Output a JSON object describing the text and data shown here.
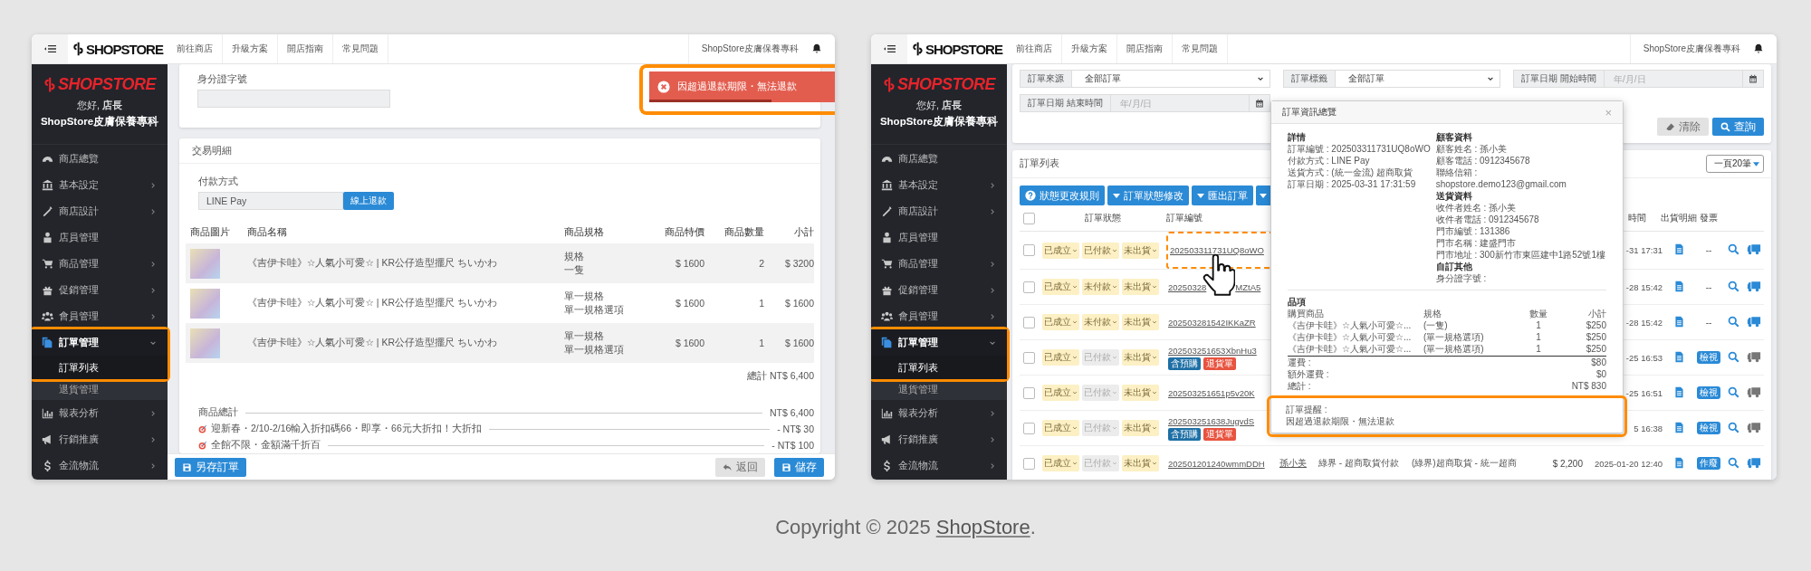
{
  "panels": [
    {
      "kind": "order_edit",
      "topbar": {
        "brand": "SHOPSTORE",
        "nav": [
          "前往商店",
          "升級方案",
          "開店指南",
          "常見問題"
        ],
        "store": "ShopStore皮膚保養專科"
      },
      "sidebar": {
        "brand": "SHOPSTORE",
        "greeting": "您好, **店長**",
        "store": "ShopStore皮膚保養專科",
        "menu": [
          {
            "label": "商店總覽",
            "expandable": false,
            "selected": false,
            "highlighted": false
          },
          {
            "label": "基本設定",
            "expandable": true,
            "expanded": false,
            "selected": false,
            "highlighted": false
          },
          {
            "label": "商店設計",
            "expandable": true,
            "expanded": false,
            "selected": false,
            "highlighted": false
          },
          {
            "label": "店員管理",
            "expandable": false,
            "selected": false,
            "highlighted": false
          },
          {
            "label": "商品管理",
            "expandable": true,
            "expanded": false,
            "selected": false,
            "highlighted": false
          },
          {
            "label": "促銷管理",
            "expandable": true,
            "expanded": false,
            "selected": false,
            "highlighted": false
          },
          {
            "label": "會員管理",
            "expandable": true,
            "expanded": false,
            "selected": false,
            "highlighted": false
          },
          {
            "label": "訂單管理",
            "expandable": true,
            "expanded": true,
            "selected": true,
            "highlighted": true,
            "children": [
              {
                "label": "訂單列表",
                "selected": true,
                "highlighted": true
              },
              {
                "label": "退貨管理",
                "selected": false,
                "highlighted": false
              }
            ]
          },
          {
            "label": "報表分析",
            "expandable": true,
            "expanded": false,
            "selected": false,
            "highlighted": false
          },
          {
            "label": "行銷推廣",
            "expandable": true,
            "expanded": false,
            "selected": false,
            "highlighted": false
          },
          {
            "label": "金流物流",
            "expandable": true,
            "expanded": false,
            "selected": false,
            "highlighted": false
          }
        ]
      },
      "main": {
        "id_field": {
          "label": "身分證字號"
        },
        "toast": {
          "message": "因超過退款期限・無法退款",
          "level": 0.62,
          "highlighted": true
        },
        "transaction": {
          "title": "交易明細",
          "payment_label": "付款方式",
          "payment_value": "LINE Pay",
          "refund_button": "線上退款",
          "columns": [
            "商品圖片",
            "商品名稱",
            "商品規格",
            "商品特價",
            "商品數量",
            "小計"
          ],
          "rows": [
            {
              "name": "《吉伊卡哇》☆人氣小可愛☆ | KR公仔造型擺尺 ちいかわ",
              "spec": [
                "規格",
                "一隻"
              ],
              "price": "$ 1600",
              "qty": "2",
              "subtotal": "$ 3200"
            },
            {
              "name": "《吉伊卡哇》☆人氣小可愛☆ | KR公仔造型擺尺 ちいかわ",
              "spec": [
                "單一規格",
                "單一規格選項"
              ],
              "price": "$ 1600",
              "qty": "1",
              "subtotal": "$ 1600"
            },
            {
              "name": "《吉伊卡哇》☆人氣小可愛☆ | KR公仔造型擺尺 ちいかわ",
              "spec": [
                "單一規格",
                "單一規格選項"
              ],
              "price": "$ 1600",
              "qty": "1",
              "subtotal": "$ 1600"
            }
          ],
          "total": "總計 NT$ 6,400",
          "summary": [
            {
              "kind": "plain",
              "label": "商品總計",
              "amount": "NT$ 6,400"
            },
            {
              "kind": "promo",
              "label": "迎新春・2/10-2/16輸入折扣碼66・即享・66元大折扣！大折扣",
              "amount": "- NT$ 30"
            },
            {
              "kind": "promo",
              "label": "全館不限・金額滿千折百",
              "amount": "- NT$ 100"
            }
          ]
        },
        "footer": {
          "save_as": "另存訂單",
          "back": {
            "label": "返回",
            "disabled": true
          },
          "save": "儲存"
        }
      }
    },
    {
      "kind": "order_list",
      "topbar": {
        "brand": "SHOPSTORE",
        "nav": [
          "前往商店",
          "升級方案",
          "開店指南",
          "常見問題"
        ],
        "store": "ShopStore皮膚保養專科"
      },
      "sidebar": {
        "brand": "SHOPSTORE",
        "greeting": "您好, **店長**",
        "store": "ShopStore皮膚保養專科",
        "menu": [
          {
            "label": "商店總覽",
            "expandable": false,
            "selected": false,
            "highlighted": false
          },
          {
            "label": "基本設定",
            "expandable": true,
            "expanded": false,
            "selected": false,
            "highlighted": false
          },
          {
            "label": "商店設計",
            "expandable": true,
            "expanded": false,
            "selected": false,
            "highlighted": false
          },
          {
            "label": "店員管理",
            "expandable": false,
            "selected": false,
            "highlighted": false
          },
          {
            "label": "商品管理",
            "expandable": true,
            "expanded": false,
            "selected": false,
            "highlighted": false
          },
          {
            "label": "促銷管理",
            "expandable": true,
            "expanded": false,
            "selected": false,
            "highlighted": false
          },
          {
            "label": "會員管理",
            "expandable": true,
            "expanded": false,
            "selected": false,
            "highlighted": false
          },
          {
            "label": "訂單管理",
            "expandable": true,
            "expanded": true,
            "selected": true,
            "highlighted": true,
            "children": [
              {
                "label": "訂單列表",
                "selected": true,
                "highlighted": true
              },
              {
                "label": "退貨管理",
                "selected": false,
                "highlighted": false
              }
            ]
          },
          {
            "label": "報表分析",
            "expandable": true,
            "expanded": false,
            "selected": false,
            "highlighted": false
          },
          {
            "label": "行銷推廣",
            "expandable": true,
            "expanded": false,
            "selected": false,
            "highlighted": false
          },
          {
            "label": "金流物流",
            "expandable": true,
            "expanded": false,
            "selected": false,
            "highlighted": false
          }
        ]
      },
      "main": {
        "filters": [
          {
            "kind": "select",
            "label": "訂單來源",
            "value": "全部訂單"
          },
          {
            "kind": "select",
            "label": "訂單標籤",
            "value": "全部訂單"
          },
          {
            "kind": "date",
            "label": "訂單日期 開始時間",
            "placeholder": "年/月/日"
          },
          {
            "kind": "date",
            "label": "訂單日期 結束時間",
            "placeholder": "年/月/日"
          }
        ],
        "clear_button": {
          "label": "清除",
          "disabled": true
        },
        "search_button": "查詢",
        "orders": {
          "title": "訂單列表",
          "page_size": "一頁20筆",
          "toolbar": [
            {
              "kind": "help",
              "label": "狀態更改規則"
            },
            {
              "kind": "dropdown",
              "label": "訂單狀態修改"
            },
            {
              "kind": "dropdown",
              "label": "匯出訂單"
            },
            {
              "kind": "dropdown"
            }
          ],
          "select_all_checked": false,
          "headers": {
            "status": "訂單狀態",
            "order_no": "訂單編號",
            "time": "時間",
            "shipping_doc": "出貨明細",
            "invoice": "發票"
          },
          "rows": [
            {
              "checked": false,
              "statuses": [
                {
                  "label": "已成立",
                  "disabled": false
                },
                {
                  "label": "已付款",
                  "disabled": false
                },
                {
                  "label": "未出貨",
                  "disabled": false
                }
              ],
              "order_no": "202503311731UQ8oWO",
              "highlighted": true,
              "time": "-31 17:31",
              "invoice": {
                "kind": "text",
                "label": "--"
              },
              "truck_active": true
            },
            {
              "checked": false,
              "statuses": [
                {
                  "label": "已成立",
                  "disabled": false
                },
                {
                  "label": "未付款",
                  "disabled": false
                },
                {
                  "label": "未出貨",
                  "disabled": false
                }
              ],
              "order_no": "20250328",
              "order_no_end": "MZtA5",
              "highlighted": false,
              "time": "-28 15:42",
              "invoice": {
                "kind": "text",
                "label": "--"
              },
              "truck_active": true
            },
            {
              "checked": false,
              "statuses": [
                {
                  "label": "已成立",
                  "disabled": false
                },
                {
                  "label": "未付款",
                  "disabled": false
                },
                {
                  "label": "未出貨",
                  "disabled": false
                }
              ],
              "order_no": "202503281542IKKaZR",
              "highlighted": false,
              "time": "-28 15:42",
              "invoice": {
                "kind": "text",
                "label": "--"
              },
              "truck_active": true
            },
            {
              "checked": false,
              "statuses": [
                {
                  "label": "已成立",
                  "disabled": false
                },
                {
                  "label": "已付款",
                  "disabled": true
                },
                {
                  "label": "未出貨",
                  "disabled": false
                }
              ],
              "order_no": "202503251653XbnHu3",
              "highlighted": false,
              "tags": [
                {
                  "label": "含預購",
                  "color": "#1d6fa5"
                },
                {
                  "label": "退貨單",
                  "color": "#e8533f"
                }
              ],
              "time": "-25 16:53",
              "invoice": {
                "kind": "badge",
                "label": "檢視"
              },
              "truck_active": false
            },
            {
              "checked": false,
              "statuses": [
                {
                  "label": "已成立",
                  "disabled": false
                },
                {
                  "label": "已付款",
                  "disabled": true
                },
                {
                  "label": "未出貨",
                  "disabled": false
                }
              ],
              "order_no": "202503251651p5v20K",
              "highlighted": false,
              "time": "-25 16:51",
              "invoice": {
                "kind": "badge",
                "label": "檢視"
              },
              "truck_active": false
            },
            {
              "checked": false,
              "statuses": [
                {
                  "label": "已成立",
                  "disabled": false
                },
                {
                  "label": "已付款",
                  "disabled": true
                },
                {
                  "label": "未出貨",
                  "disabled": false
                }
              ],
              "order_no": "202503251638JugvdS",
              "highlighted": false,
              "tags": [
                {
                  "label": "含預購",
                  "color": "#1d6fa5"
                },
                {
                  "label": "退貨單",
                  "color": "#e8533f"
                }
              ],
              "time": "5 16:38",
              "invoice": {
                "kind": "badge",
                "label": "檢視"
              },
              "truck_active": false
            },
            {
              "checked": false,
              "statuses": [
                {
                  "label": "已成立",
                  "disabled": false
                },
                {
                  "label": "已付款",
                  "disabled": true
                },
                {
                  "label": "未出貨",
                  "disabled": false
                }
              ],
              "order_no": "202501201240wmmDDH",
              "highlighted": false,
              "customer": "孫小美",
              "payment": "綠界 - 超商取貨付款",
              "shipping": "(綠界)超商取貨 - 統一超商",
              "amount": "$ 2,200",
              "time": "2025-01-20 12:40",
              "invoice": {
                "kind": "badge",
                "label": "作廢"
              },
              "truck_active": true
            }
          ]
        },
        "popup": {
          "title": "訂單資訊總覽",
          "close": "×",
          "left": [
            {
              "heading": "詳情",
              "lines": [
                "訂單編號 : 202503311731UQ8oWO",
                "付款方式 : LINE Pay",
                "送貨方式 : (統一金流) 超商取貨",
                "訂單日期 : 2025-03-31 17:31:59"
              ]
            }
          ],
          "right": [
            {
              "heading": "顧客資料",
              "lines": [
                "顧客姓名 : 孫小美",
                "顧客電話 : 0912345678",
                "聯絡信箱 :",
                "shopstore.demo123@gmail.com"
              ]
            },
            {
              "heading": "送貨資料",
              "lines": [
                "收件者姓名 : 孫小美",
                "收件者電話 : 0912345678",
                "門市編號 : 131386",
                "門市名稱 : 建盛門市",
                "門市地址 : 300新竹市東區建中1路52號1樓"
              ]
            },
            {
              "heading": "自訂其他",
              "lines": [
                "身分證字號 :"
              ]
            }
          ],
          "items_heading": "品項",
          "item_columns": [
            "購買商品",
            "規格",
            "數量",
            "小計"
          ],
          "items": [
            [
              "《吉伊卡哇》☆人氣小可愛☆...",
              "(一隻)",
              "1",
              "$250"
            ],
            [
              "《吉伊卡哇》☆人氣小可愛☆...",
              "(單一規格選項)",
              "1",
              "$250"
            ],
            [
              "《吉伊卡哇》☆人氣小可愛☆...",
              "(單一規格選項)",
              "1",
              "$250"
            ]
          ],
          "totals": [
            [
              "運費 :",
              "$80"
            ],
            [
              "額外運費 :",
              "$0"
            ],
            [
              "總計 :",
              "NT$ 830"
            ]
          ],
          "note": {
            "label": "訂單提醒 :",
            "text": "因超過退款期限・無法退款",
            "highlighted": true
          }
        }
      }
    }
  ],
  "copyright": {
    "text": "Copyright © 2025",
    "link": "ShopStore",
    "suffix": "."
  }
}
